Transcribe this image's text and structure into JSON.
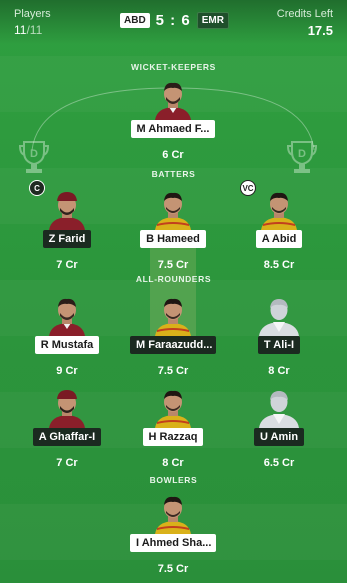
{
  "header": {
    "players_label": "Players",
    "players_count": "11",
    "players_total": "/11",
    "team_left": "ABD",
    "score": "5 : 6",
    "team_right": "EMR",
    "credits_label": "Credits Left",
    "credits_value": "17.5"
  },
  "sections": {
    "wk": "WICKET-KEEPERS",
    "bat": "BATTERS",
    "ar": "ALL-ROUNDERS",
    "bowl": "BOWLERS"
  },
  "players": {
    "p1": {
      "name": "M Ahmaed F...",
      "credit": "6 Cr"
    },
    "p2": {
      "name": "Z Farid",
      "credit": "7 Cr",
      "badge": "C"
    },
    "p3": {
      "name": "B Hameed",
      "credit": "7.5 Cr"
    },
    "p4": {
      "name": "A Abid",
      "credit": "8.5 Cr",
      "badge": "VC"
    },
    "p5": {
      "name": "R Mustafa",
      "credit": "9 Cr"
    },
    "p6": {
      "name": "M Faraazudd...",
      "credit": "7.5 Cr"
    },
    "p7": {
      "name": "T Ali-I",
      "credit": "8 Cr"
    },
    "p8": {
      "name": "A Ghaffar-I",
      "credit": "7 Cr"
    },
    "p9": {
      "name": "H Razzaq",
      "credit": "8 Cr"
    },
    "p10": {
      "name": "U Amin",
      "credit": "6.5 Cr"
    },
    "p11": {
      "name": "I Ahmed Sha...",
      "credit": "7.5 Cr"
    }
  },
  "colors": {
    "pitch": "#2e9a3e",
    "jersey_maroon": "#8a1f2a",
    "jersey_yellow": "#d9b11a",
    "badge_dark": "#1b2a20"
  }
}
